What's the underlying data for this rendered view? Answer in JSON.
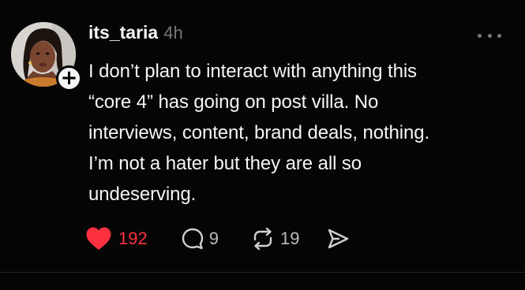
{
  "post": {
    "username": "its_taria",
    "timestamp": "4h",
    "text": "I don’t plan to interact with anything this\n“core 4” has going on post villa. No\ninterviews, content, brand deals, nothing.\nI’m not a hater but they are all so\nundeserving.",
    "likes": "192",
    "replies": "9",
    "reposts": "19",
    "liked": true
  },
  "icons": {
    "follow": "plus-icon",
    "more": "more-horizontal-icon",
    "like": "heart-icon",
    "reply": "speech-bubble-icon",
    "repost": "repost-icon",
    "share": "send-icon"
  },
  "colors": {
    "background": "#050505",
    "text": "#f3f5f7",
    "muted": "#777777",
    "like_active": "#ff3040"
  }
}
